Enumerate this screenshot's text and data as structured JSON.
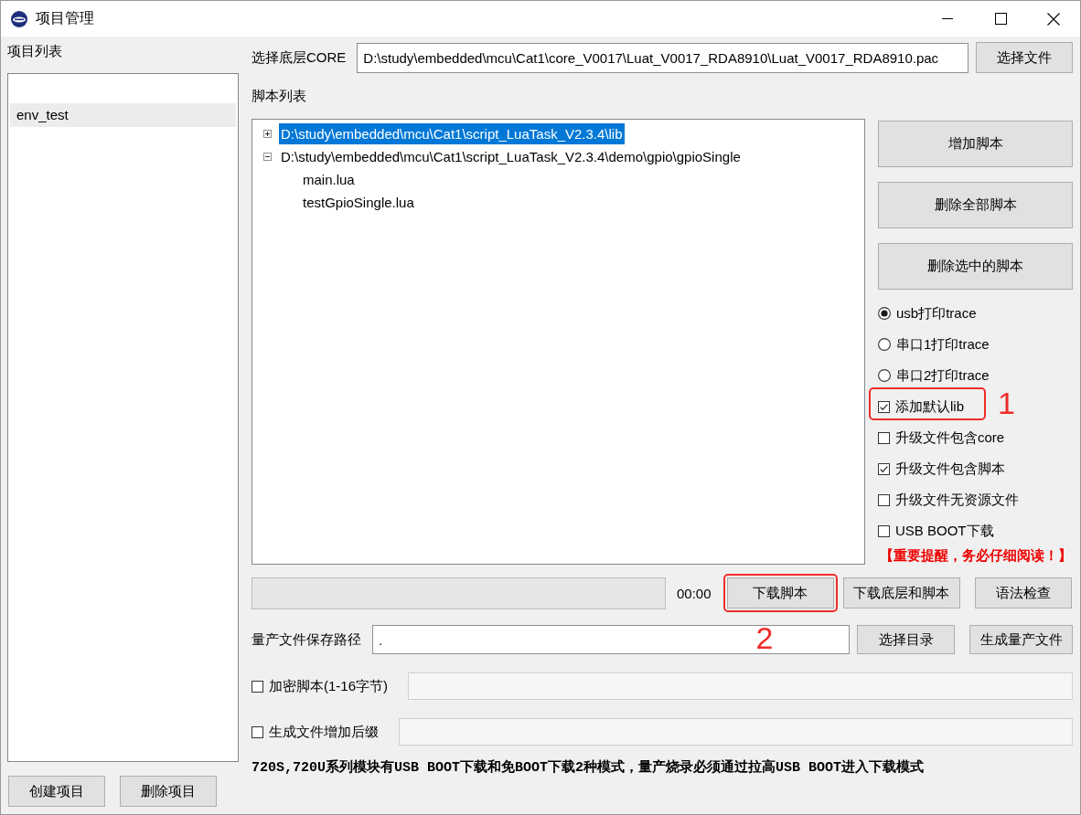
{
  "window": {
    "title": "项目管理"
  },
  "project_list": {
    "label": "项目列表",
    "items": [
      {
        "label": "env_test",
        "selected": true
      }
    ],
    "buttons": [
      {
        "label": "创建项目"
      },
      {
        "label": "删除项目"
      }
    ]
  },
  "core": {
    "label": "选择底层CORE",
    "value": "D:\\study\\embedded\\mcu\\Cat1\\core_V0017\\Luat_V0017_RDA8910\\Luat_V0017_RDA8910.pac",
    "button": "选择文件"
  },
  "script_list": {
    "label": "脚本列表",
    "tree": [
      {
        "label": "D:\\study\\embedded\\mcu\\Cat1\\script_LuaTask_V2.3.4\\lib",
        "expanded": false,
        "selected": true
      },
      {
        "label": "D:\\study\\embedded\\mcu\\Cat1\\script_LuaTask_V2.3.4\\demo\\gpio\\gpioSingle",
        "expanded": true,
        "selected": false,
        "children": [
          {
            "label": "main.lua",
            "selected": false
          },
          {
            "label": "testGpioSingle.lua",
            "selected": false
          }
        ]
      }
    ]
  },
  "actions": [
    {
      "label": "增加脚本"
    },
    {
      "label": "删除全部脚本"
    },
    {
      "label": "删除选中的脚本"
    }
  ],
  "trace_output": [
    {
      "label": "usb打印trace",
      "selected": true
    },
    {
      "label": "串口1打印trace",
      "selected": false
    },
    {
      "label": "串口2打印trace",
      "selected": false
    }
  ],
  "options": [
    {
      "label": "添加默认lib",
      "checked": true,
      "callout": "1"
    },
    {
      "label": "升级文件包含core",
      "checked": false
    },
    {
      "label": "升级文件包含脚本",
      "checked": true
    },
    {
      "label": "升级文件无资源文件",
      "checked": false
    },
    {
      "label": "USB BOOT下载",
      "checked": false
    }
  ],
  "notice": "【重要提醒，务必仔细阅读！】",
  "download": {
    "progress": {
      "level": 0
    },
    "time": "00:00",
    "buttons": [
      {
        "label": "下载脚本",
        "callout": "2"
      },
      {
        "label": "下载底层和脚本"
      },
      {
        "label": "语法检查"
      }
    ]
  },
  "output_path": {
    "label": "量产文件保存路径",
    "value": ".",
    "buttons": [
      {
        "label": "选择目录"
      },
      {
        "label": "生成量产文件"
      }
    ]
  },
  "encrypt": {
    "label": "加密脚本(1-16字节)",
    "checked": false,
    "field": {
      "disabled": true
    }
  },
  "suffix": {
    "label": "生成文件增加后缀",
    "checked": false,
    "field": {
      "disabled": true
    }
  },
  "note": "720S,720U系列模块有USB BOOT下载和免BOOT下载2种模式，量产烧录必须通过拉高USB BOOT进入下载模式"
}
